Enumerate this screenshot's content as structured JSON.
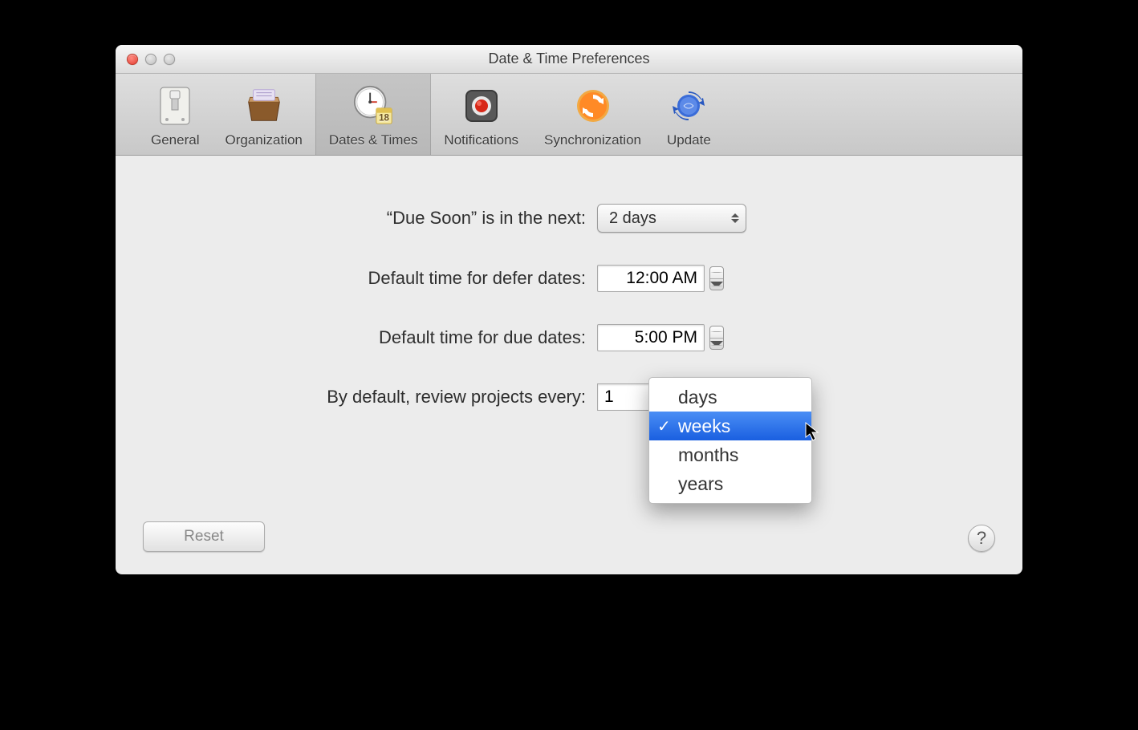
{
  "window": {
    "title": "Date & Time Preferences"
  },
  "toolbar": {
    "items": [
      {
        "label": "General"
      },
      {
        "label": "Organization"
      },
      {
        "label": "Dates & Times"
      },
      {
        "label": "Notifications"
      },
      {
        "label": "Synchronization"
      },
      {
        "label": "Update"
      }
    ],
    "active_index": 2
  },
  "prefs": {
    "due_soon": {
      "label": "“Due Soon” is in the next:",
      "value": "2 days"
    },
    "defer_time": {
      "label": "Default time for defer dates:",
      "value": "12:00 AM"
    },
    "due_time": {
      "label": "Default time for due dates:",
      "value": "5:00 PM"
    },
    "review": {
      "label": "By default, review projects every:",
      "number": "1",
      "unit": "weeks",
      "options": [
        "days",
        "weeks",
        "months",
        "years"
      ]
    }
  },
  "buttons": {
    "reset": "Reset",
    "help": "?"
  }
}
